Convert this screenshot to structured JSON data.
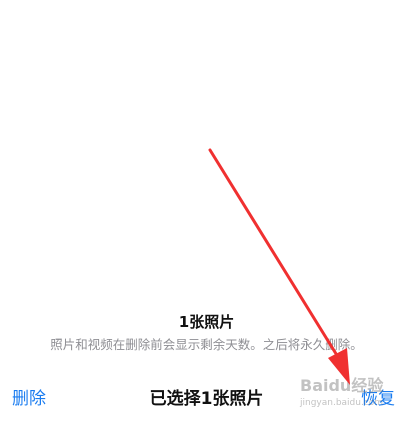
{
  "info": {
    "title": "1张照片",
    "subtitle": "照片和视频在删除前会显示剩余天数。之后将永久删除。"
  },
  "toolbar": {
    "delete_label": "删除",
    "selection_title": "已选择1张照片",
    "restore_label": "恢复"
  },
  "watermark": {
    "brand": "Baidu经验",
    "url": "jingyan.baidu.com"
  },
  "colors": {
    "accent": "#1a7cf0",
    "annotation_arrow": "#f03030"
  }
}
